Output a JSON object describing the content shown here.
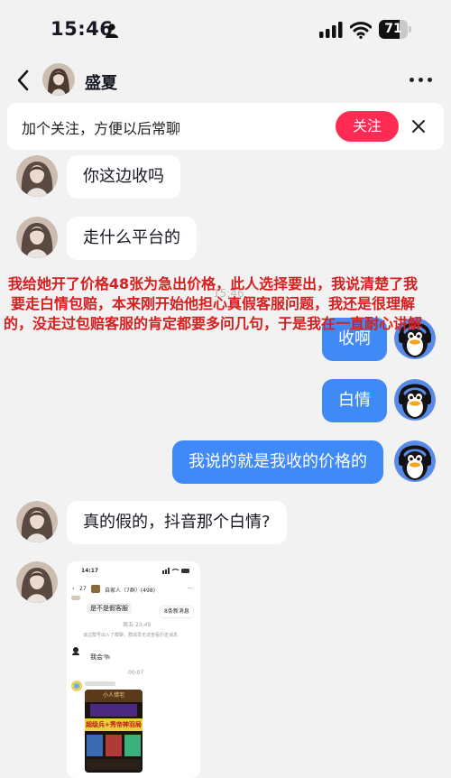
{
  "status_bar": {
    "time": "15:46",
    "battery_text": "71",
    "battery_level": 0.71
  },
  "header": {
    "contact_name": "盛夏"
  },
  "follow_banner": {
    "text": "加个关注，方便以后常聊",
    "button_label": "关注"
  },
  "messages": {
    "m1": "你这边收吗",
    "m2": "走什么平台的",
    "m3": "收啊",
    "m4": "白情",
    "m5": "我说的就是我收的价格的",
    "m6": "真的假的，抖音那个白情?"
  },
  "timestamp": "15:46",
  "annotation": "我给她开了价格48张为急出价格，此人选择要出，我说清楚了我要走白情包赔，本来刚开始他担心真假客服问题，我还是很理解的，没走过包赔客服的肯定都要多问几句，于是我在一直耐心讲解",
  "screenshot": {
    "time": "14:17",
    "back_count": "27",
    "group_name": "自家人（7群）(498)",
    "bubble1": "是不是假客服",
    "time1": "周五 23:49",
    "unread": "8条新消息",
    "notice": "该过群号出入了群聊，群成员无法查看历史消息",
    "bubble2": "我会🐃",
    "time2": "00:07",
    "card_header": "小人惜宅",
    "card_banner": "超级兵+秀帝神羽局"
  },
  "colors": {
    "accent_red": "#fe2c55",
    "outgoing_bubble": "#3f8af7",
    "annotation": "#d81e1e"
  }
}
